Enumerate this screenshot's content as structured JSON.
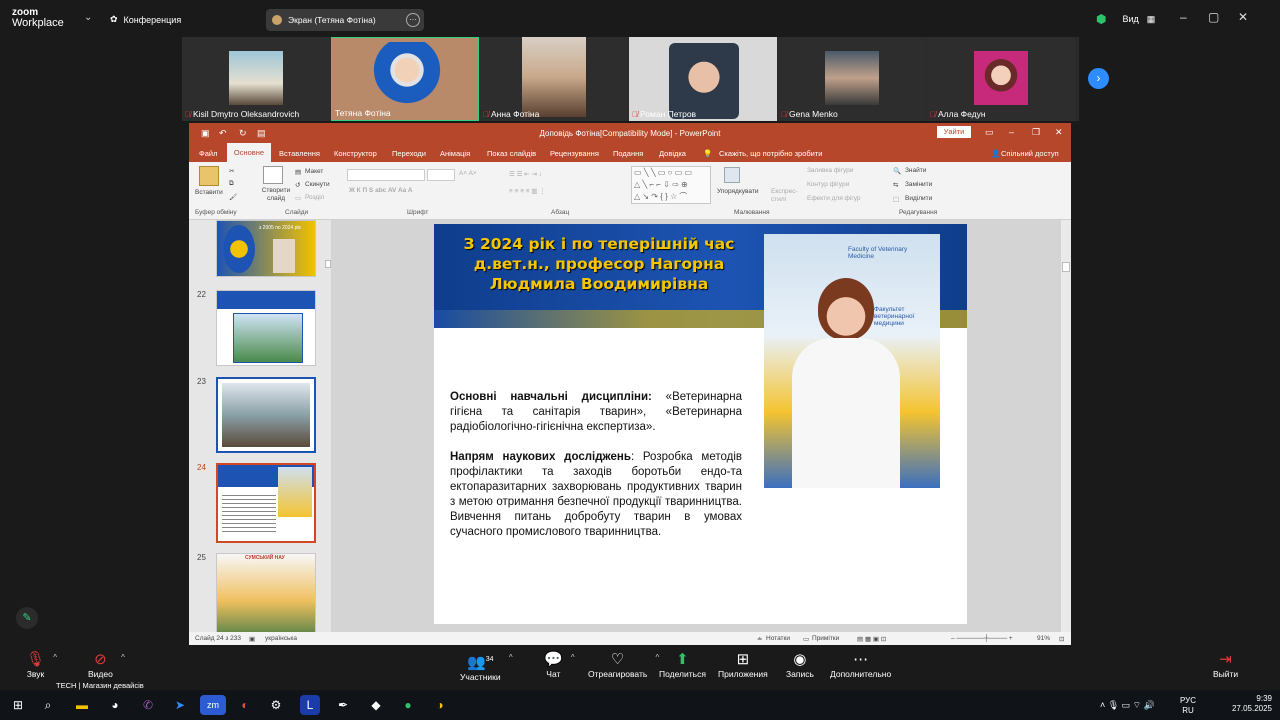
{
  "zoom": {
    "logo_line1": "zoom",
    "logo_line2": "Workplace",
    "conference_label": "Конференция",
    "screen_share_label": "Экран (Тетяна Фотіна)",
    "view_label": "Вид"
  },
  "participants": [
    {
      "name": "Kisil Dmytro Oleksandrovich",
      "muted": true
    },
    {
      "name": "Тетяна Фотіна",
      "muted": false
    },
    {
      "name": "Анна Фотіна",
      "muted": true
    },
    {
      "name": "Роман Петров",
      "muted": true
    },
    {
      "name": "Gena Menko",
      "muted": true
    },
    {
      "name": "Алла Федун",
      "muted": true
    }
  ],
  "ppt": {
    "window_title": "Доповідь Фотіна[Compatibility Mode] - PowerPoint",
    "sign_in": "Уайти",
    "tabs": [
      "Файл",
      "Основне",
      "Вставлення",
      "Конструктор",
      "Переходи",
      "Анімація",
      "Показ слайдів",
      "Рецензування",
      "Подання",
      "Довідка",
      "Скажіть, що потрібно зробити",
      "Спільний доступ"
    ],
    "ribbon": {
      "paste": "Вставити",
      "new_slide": "Створити слайд",
      "layout": "Макет",
      "reset": "Скинути",
      "section": "Розділ",
      "groups": [
        "Буфер обміну",
        "Слайди",
        "Шрифт",
        "Абзац",
        "Малювання",
        "Редагування"
      ],
      "arrange": "Упорядкувати",
      "quick_styles": "Експрес-стилі",
      "shape_fill": "Заливка фігури",
      "shape_outline": "Контур фігури",
      "shape_effects": "Ефекти для фігур",
      "find": "Знайти",
      "replace": "Замінити",
      "select": "Виділити"
    },
    "thumbnails": [
      {
        "num": "",
        "caption": "з 2005 по 2024 рік"
      },
      {
        "num": "22",
        "caption": ""
      },
      {
        "num": "23",
        "caption": ""
      },
      {
        "num": "24",
        "caption": ""
      },
      {
        "num": "25",
        "caption": "СУМСЬКИЙ НАУ"
      }
    ],
    "slide": {
      "title": "З 2024 рік і по теперішній час д.вет.н., професор Нагорна Людмила Воодимирівна",
      "para1_bold": "Основні навчальні дисципліни:",
      "para1_text": " «Ветеринарна гігієна та санітарія тварин», «Ветеринарна радіобіологічно-гігієнічна експертиза».",
      "para2_bold": "Напрям наукових досліджень",
      "para2_text": ": Розробка методів профілактики та заходів боротьби ендо-та ектопаразитарних захворювань продуктивних тварин з метою отримання безпечної продукції тваринництва. Вивчення питань добробуту тварин в умовах сучасного промислового тваринництва.",
      "photo_text1": "Faculty of Veterinary Medicine",
      "photo_text2": "Факультет ветеринарної медицини"
    },
    "status": {
      "slide_of": "Слайд 24 з 233",
      "language": "українська",
      "notes": "Нотатки",
      "comments": "Примітки",
      "zoom": "91%"
    }
  },
  "zoom_toolbar": {
    "audio": "Звук",
    "video": "Видео",
    "participants": "Участники",
    "participants_count": "34",
    "chat": "Чат",
    "react": "Отреагировать",
    "share": "Поделиться",
    "apps": "Приложения",
    "record": "Запись",
    "more": "Дополнительно",
    "leave": "Выйти"
  },
  "taskbar": {
    "toast": "TECH | Магазин девайсів",
    "lang1": "РУС",
    "lang2": "RU",
    "time": "9:39",
    "date": "27.05.2025",
    "accent": "#2d8cff"
  }
}
